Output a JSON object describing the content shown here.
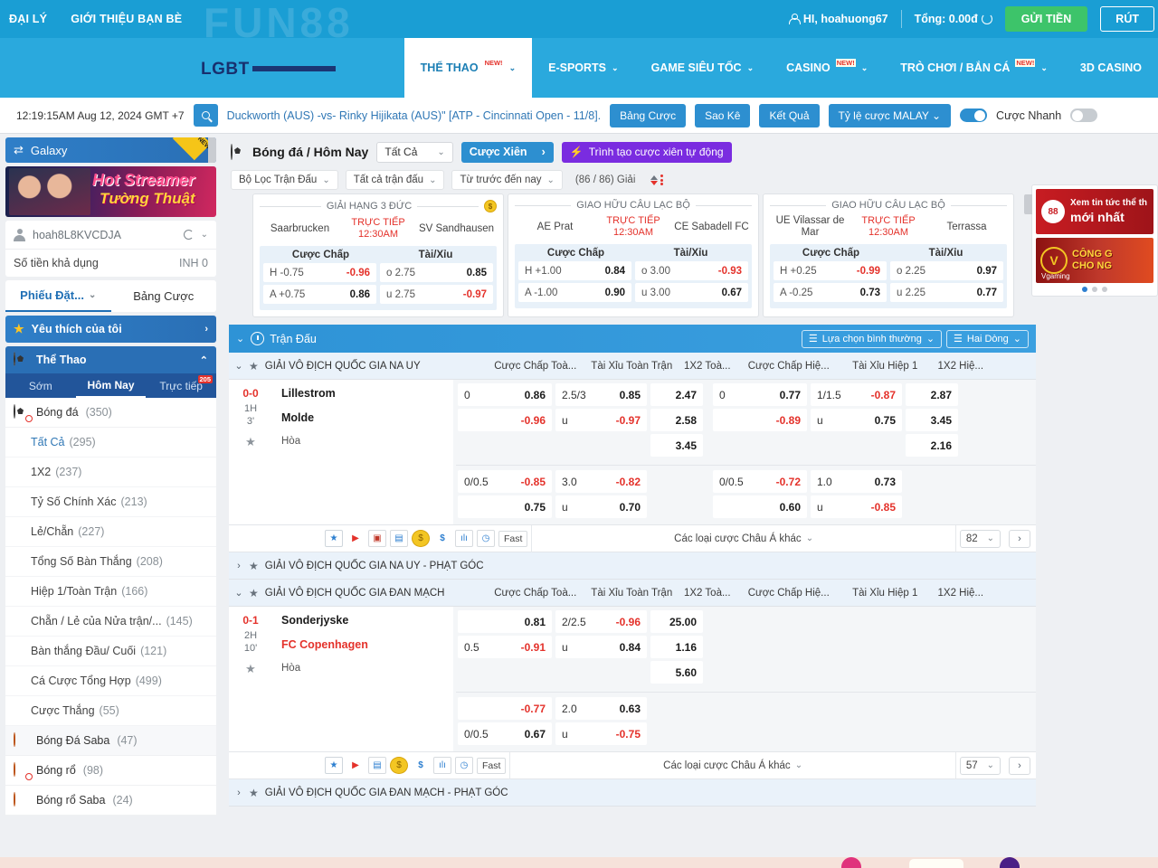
{
  "topbar": {
    "links": [
      "ĐẠI LÝ",
      "GIỚI THIỆU BẠN BÈ"
    ],
    "greeting": "HI, hoahuong67",
    "balance_label": "Tổng: 0.00đ",
    "deposit_button": "GỬI TIỀN",
    "withdraw_button": "RÚT"
  },
  "brand": {
    "ghost": "FUN88",
    "name": "LGBT",
    "tagline": ""
  },
  "nav": [
    {
      "label": "THỂ THAO",
      "new": "NEW!",
      "active": true
    },
    {
      "label": "E-SPORTS",
      "new": "",
      "active": false
    },
    {
      "label": "GAME SIÊU TỐC",
      "new": "",
      "active": false
    },
    {
      "label": "CASINO",
      "new": "NEW!",
      "active": false
    },
    {
      "label": "TRÒ CHƠI / BẮN CÁ",
      "new": "NEW!",
      "active": false
    },
    {
      "label": "3D CASINO",
      "new": "",
      "active": false
    }
  ],
  "searchrow": {
    "clock": "12:19:15AM Aug 12, 2024 GMT +7",
    "ticker": "Duckworth (AUS) -vs- Rinky Hijikata (AUS)\" [ATP - Cincinnati Open - 11/8].",
    "buttons": [
      "Bảng Cược",
      "Sao Kê",
      "Kết Quả"
    ],
    "odds_format": "Tỷ lệ cược MALAY",
    "quickbet_label": "Cược Nhanh"
  },
  "sidebar": {
    "galaxy": {
      "label": "Galaxy",
      "flag": "NEW"
    },
    "promo": {
      "line1": "Hot Streamer",
      "line2": "Tường Thuật"
    },
    "account": {
      "username": "hoah8L8KVCDJA",
      "balance_label": "Số tiền khả dụng",
      "balance_value": "INH 0"
    },
    "tabs": [
      {
        "label": "Phiếu Đặt...",
        "active": true
      },
      {
        "label": "Bảng Cược",
        "active": false
      }
    ],
    "favorites": "Yêu thích của tôi",
    "sports_header": "Thể Thao",
    "subtabs": [
      {
        "label": "Sớm",
        "active": false,
        "badge": ""
      },
      {
        "label": "Hôm Nay",
        "active": true,
        "badge": ""
      },
      {
        "label": "Trực tiếp",
        "active": false,
        "badge": "205"
      }
    ],
    "football": {
      "label": "Bóng đá",
      "count": "(350)"
    },
    "markets": [
      {
        "label": "Tất Cả",
        "count": "(295)",
        "selected": true
      },
      {
        "label": "1X2",
        "count": "(237)",
        "selected": false
      },
      {
        "label": "Tỷ Số Chính Xác",
        "count": "(213)",
        "selected": false
      },
      {
        "label": "Lẻ/Chẵn",
        "count": "(227)",
        "selected": false
      },
      {
        "label": "Tổng Số Bàn Thắng",
        "count": "(208)",
        "selected": false
      },
      {
        "label": "Hiệp 1/Toàn Trận",
        "count": "(166)",
        "selected": false
      },
      {
        "label": "Chẵn / Lẻ của Nửa trận/...",
        "count": "(145)",
        "selected": false
      },
      {
        "label": "Bàn thắng Đầu/ Cuối",
        "count": "(121)",
        "selected": false
      },
      {
        "label": "Cá Cược Tổng Hợp",
        "count": "(499)",
        "selected": false
      },
      {
        "label": "Cược Thắng",
        "count": "(55)",
        "selected": false
      }
    ],
    "other_sports": [
      {
        "label": "Bóng Đá Saba",
        "count": "(47)",
        "icon": "soccer-icon"
      },
      {
        "label": "Bóng rổ",
        "count": "(98)",
        "icon": "basketball-icon"
      },
      {
        "label": "Bóng rổ Saba",
        "count": "(24)",
        "icon": "basketball-icon"
      }
    ]
  },
  "main": {
    "title": "Bóng đá / Hôm Nay",
    "scope_select": "Tất Cả",
    "parlay_button": "Cược Xiên",
    "auto_parlay_button": "Trình tạo cược xiên tự động",
    "filters": {
      "match_filter": "Bộ Lọc Trận Đấu",
      "all_matches": "Tất cả trận đấu",
      "time_range": "Từ trước đến nay",
      "count": "(86 / 86) Giải"
    },
    "cards": [
      {
        "league": "GIẢI HẠNG 3 ĐỨC",
        "home": "Saarbrucken",
        "away": "SV Sandhausen",
        "live_label": "TRỰC TIẾP",
        "time": "12:30AM",
        "col1": "Cược Chấp",
        "col2": "Tài/Xỉu",
        "rows": [
          {
            "h": "H -0.75",
            "hv": "-0.96",
            "hneg": true,
            "o": "o 2.75",
            "ov": "0.85",
            "oneg": false
          },
          {
            "h": "A +0.75",
            "hv": "0.86",
            "hneg": false,
            "o": "u 2.75",
            "ov": "-0.97",
            "oneg": true
          }
        ]
      },
      {
        "league": "GIAO HỮU CÂU LẠC BỘ",
        "home": "AE Prat",
        "away": "CE Sabadell FC",
        "live_label": "TRỰC TIẾP",
        "time": "12:30AM",
        "col1": "Cược Chấp",
        "col2": "Tài/Xỉu",
        "rows": [
          {
            "h": "H +1.00",
            "hv": "0.84",
            "hneg": false,
            "o": "o 3.00",
            "ov": "-0.93",
            "oneg": true
          },
          {
            "h": "A -1.00",
            "hv": "0.90",
            "hneg": false,
            "o": "u 3.00",
            "ov": "0.67",
            "oneg": false
          }
        ]
      },
      {
        "league": "GIAO HỮU CÂU LẠC BỘ",
        "home": "UE Vilassar de Mar",
        "away": "Terrassa",
        "live_label": "TRỰC TIẾP",
        "time": "12:30AM",
        "col1": "Cược Chấp",
        "col2": "Tài/Xỉu",
        "rows": [
          {
            "h": "H +0.25",
            "hv": "-0.99",
            "hneg": true,
            "o": "o 2.25",
            "ov": "0.97",
            "oneg": false
          },
          {
            "h": "A -0.25",
            "hv": "0.73",
            "hneg": false,
            "o": "u 2.25",
            "ov": "0.77",
            "oneg": false
          }
        ]
      }
    ],
    "table_header": {
      "title": "Trận Đấu",
      "view_select": "Lựa chọn bình thường",
      "rows_select": "Hai Dòng"
    },
    "columns": [
      "Cược Chấp Toà...",
      "Tài Xỉu Toàn Trận",
      "1X2 Toà...",
      "Cược Chấp Hiệ...",
      "Tài Xỉu Hiệp 1",
      "1X2 Hiệ..."
    ],
    "leagues": [
      {
        "name": "GIẢI VÔ ĐỊCH QUỐC GIA NA UY",
        "match": {
          "score": "0-0",
          "period": "1H",
          "minute": "3'",
          "home": "Lillestrom",
          "away": "Molde",
          "draw": "Hòa",
          "home_red": false,
          "away_red": false,
          "ft_hdp": [
            {
              "l": "0",
              "v": "0.86",
              "neg": false
            },
            {
              "l": "",
              "v": "-0.96",
              "neg": true
            }
          ],
          "ft_ou": [
            {
              "l": "2.5/3",
              "v": "0.85",
              "neg": false
            },
            {
              "l": "u",
              "v": "-0.97",
              "neg": true
            }
          ],
          "ft_1x2": [
            {
              "l": "",
              "v": "2.47",
              "neg": false
            },
            {
              "l": "",
              "v": "2.58",
              "neg": false
            },
            {
              "l": "",
              "v": "3.45",
              "neg": false
            }
          ],
          "h1_hdp": [
            {
              "l": "0",
              "v": "0.77",
              "neg": false
            },
            {
              "l": "",
              "v": "-0.89",
              "neg": true
            }
          ],
          "h1_ou": [
            {
              "l": "1/1.5",
              "v": "-0.87",
              "neg": true
            },
            {
              "l": "u",
              "v": "0.75",
              "neg": false
            }
          ],
          "h1_1x2": [
            {
              "l": "",
              "v": "2.87",
              "neg": false
            },
            {
              "l": "",
              "v": "3.45",
              "neg": false
            },
            {
              "l": "",
              "v": "2.16",
              "neg": false
            }
          ],
          "ft_hdp2": [
            {
              "l": "0/0.5",
              "v": "-0.85",
              "neg": true
            },
            {
              "l": "",
              "v": "0.75",
              "neg": false
            }
          ],
          "ft_ou2": [
            {
              "l": "3.0",
              "v": "-0.82",
              "neg": true
            },
            {
              "l": "u",
              "v": "0.70",
              "neg": false
            }
          ],
          "h1_hdp2": [
            {
              "l": "0/0.5",
              "v": "-0.72",
              "neg": true
            },
            {
              "l": "",
              "v": "0.60",
              "neg": false
            }
          ],
          "h1_ou2": [
            {
              "l": "1.0",
              "v": "0.73",
              "neg": false
            },
            {
              "l": "u",
              "v": "-0.85",
              "neg": true
            }
          ]
        },
        "action": {
          "fast": "Fast",
          "more": "Các loại cược Châu Á khác",
          "page": "82"
        },
        "sub": "GIẢI VÔ ĐỊCH QUỐC GIA NA UY - PHẠT GÓC"
      },
      {
        "name": "GIẢI VÔ ĐỊCH QUỐC GIA ĐAN MẠCH",
        "match": {
          "score": "0-1",
          "period": "2H",
          "minute": "10'",
          "home": "Sonderjyske",
          "away": "FC Copenhagen",
          "draw": "Hòa",
          "home_red": false,
          "away_red": true,
          "ft_hdp": [
            {
              "l": "",
              "v": "0.81",
              "neg": false
            },
            {
              "l": "0.5",
              "v": "-0.91",
              "neg": true
            }
          ],
          "ft_ou": [
            {
              "l": "2/2.5",
              "v": "-0.96",
              "neg": true
            },
            {
              "l": "u",
              "v": "0.84",
              "neg": false
            }
          ],
          "ft_1x2": [
            {
              "l": "",
              "v": "25.00",
              "neg": false
            },
            {
              "l": "",
              "v": "1.16",
              "neg": false
            },
            {
              "l": "",
              "v": "5.60",
              "neg": false
            }
          ],
          "h1_hdp": [],
          "h1_ou": [],
          "h1_1x2": [],
          "ft_hdp2": [
            {
              "l": "",
              "v": "-0.77",
              "neg": true
            },
            {
              "l": "0/0.5",
              "v": "0.67",
              "neg": false
            }
          ],
          "ft_ou2": [
            {
              "l": "2.0",
              "v": "0.63",
              "neg": false
            },
            {
              "l": "u",
              "v": "-0.75",
              "neg": true
            }
          ],
          "h1_hdp2": [],
          "h1_ou2": []
        },
        "action": {
          "fast": "Fast",
          "more": "Các loại cược Châu Á khác",
          "page": "57"
        },
        "sub": "GIẢI VÔ ĐỊCH QUỐC GIA ĐAN MẠCH - PHẠT GÓC"
      }
    ]
  },
  "ads": {
    "ad1_small": "Xem tin tức thể th",
    "ad1_big": "mới nhất",
    "ad2_brand": "Vgaming",
    "ad2_line1": "CÔNG G",
    "ad2_line2": "CHO NG"
  }
}
